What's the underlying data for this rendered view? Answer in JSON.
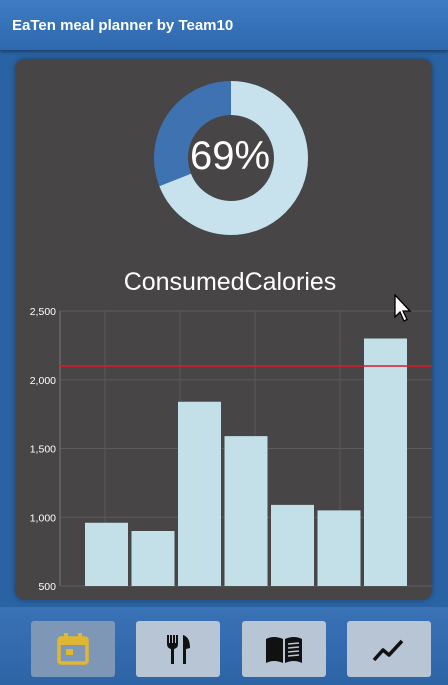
{
  "app": {
    "title": "EaTen meal planner by Team10"
  },
  "progress": {
    "label": "69%",
    "fraction": 0.69,
    "ring_color": "#c7e2ec",
    "remainder_color": "#3f72b0"
  },
  "chart_data": {
    "type": "bar",
    "title": "ConsumedCalories",
    "xlabel": "",
    "ylabel": "",
    "ylim": [
      500,
      2500
    ],
    "y_ticks": [
      "2,500",
      "2,000",
      "1,500",
      "1,000",
      "500"
    ],
    "y_tick_values": [
      2500,
      2000,
      1500,
      1000,
      500
    ],
    "values": [
      960,
      900,
      1840,
      1590,
      1090,
      1050,
      2300
    ],
    "target_line": 2100,
    "bar_color": "#c3dfe7",
    "target_color": "#e0192a",
    "grid": true
  },
  "nav": {
    "items": [
      {
        "name": "calendar",
        "icon": "calendar-icon",
        "active": true
      },
      {
        "name": "meals",
        "icon": "fork-knife-icon",
        "active": false
      },
      {
        "name": "recipes",
        "icon": "open-book-icon",
        "active": false
      },
      {
        "name": "stats",
        "icon": "trend-chart-icon",
        "active": false
      }
    ],
    "active_icon_color": "#e0b733",
    "icon_color": "#111111"
  }
}
